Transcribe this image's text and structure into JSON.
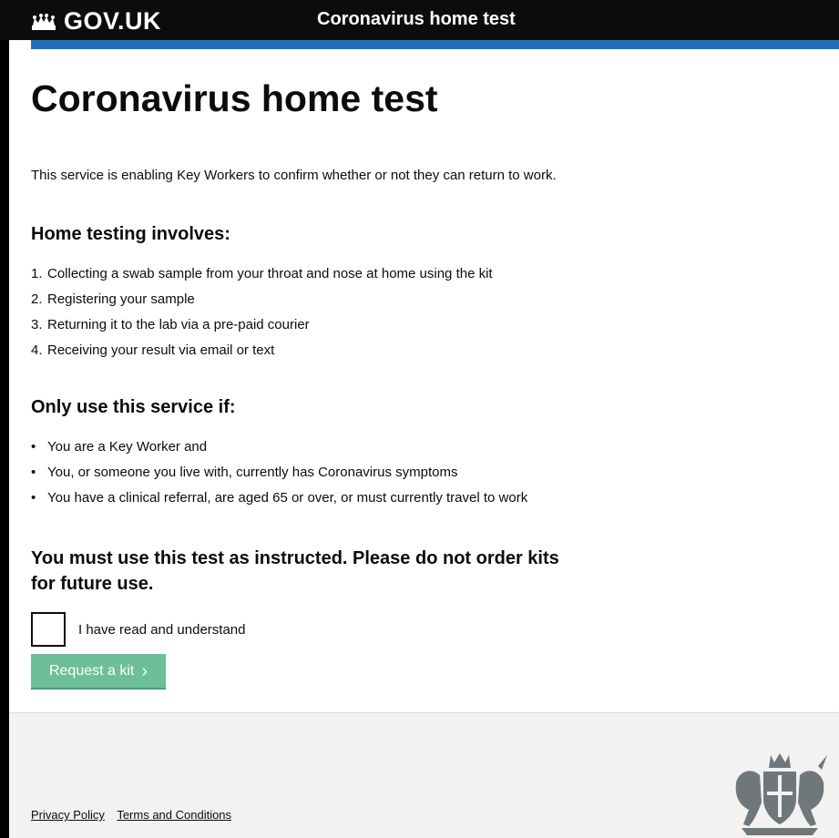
{
  "header": {
    "logo_text": "GOV.UK",
    "service_name": "Coronavirus home test",
    "logo_icon": "crown-icon"
  },
  "main": {
    "title": "Coronavirus home test",
    "intro": "This service is enabling Key Workers to confirm whether or not they can return to work.",
    "home_testing_heading": "Home testing involves:",
    "steps": [
      {
        "marker": "1.",
        "text": "Collecting a swab sample from your throat and nose at home using the kit"
      },
      {
        "marker": "2.",
        "text": "Registering your sample"
      },
      {
        "marker": "3.",
        "text": "Returning it to the lab via a pre-paid courier"
      },
      {
        "marker": "4.",
        "text": "Receiving your result via email or text"
      }
    ],
    "only_use_heading": "Only use this service if:",
    "conditions": [
      {
        "marker": "•",
        "text": "You are a Key Worker and"
      },
      {
        "marker": "•",
        "text": "You, or someone you live with, currently has Coronavirus symptoms"
      },
      {
        "marker": "•",
        "text": "You have a clinical referral, are aged 65 or over, or must currently travel to work"
      }
    ],
    "emphasis": "You must use this test as instructed. Please do not order kits for future use.",
    "checkbox_label": "I have read and understand",
    "checkbox_checked": false,
    "button_label": "Request a kit",
    "button_icon": "chevron-right-icon",
    "button_color": "#6cbf96"
  },
  "footer": {
    "links": [
      "Privacy Policy",
      "Terms and Conditions"
    ],
    "crest_icon": "royal-coat-of-arms-icon"
  },
  "colors": {
    "header_bg": "#0b0c0c",
    "stripe": "#1d70b8",
    "footer_bg": "#f3f2f1"
  }
}
